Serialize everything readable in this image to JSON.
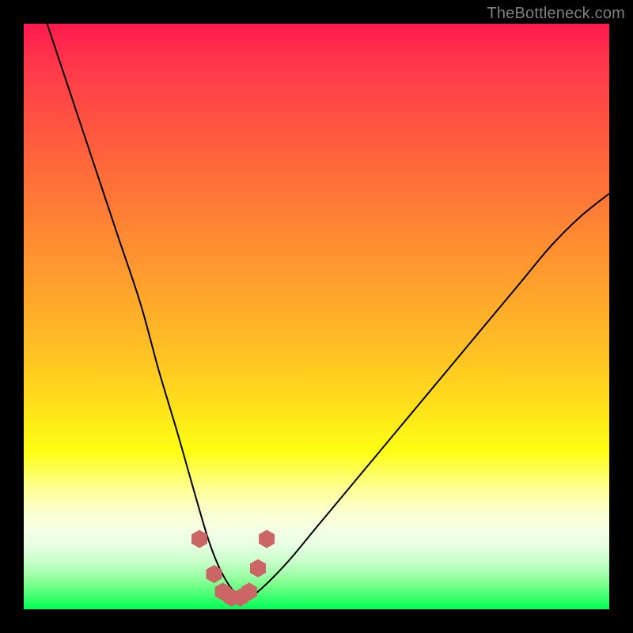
{
  "watermark": "TheBottleneck.com",
  "colors": {
    "frame": "#000000",
    "gradient_top": "#ff1a4f",
    "gradient_bottom": "#00ff57",
    "curve": "#000000",
    "points": "#cc6666",
    "watermark": "#808080"
  },
  "chart_data": {
    "type": "line",
    "title": "",
    "xlabel": "",
    "ylabel": "",
    "xlim": [
      0,
      100
    ],
    "ylim": [
      0,
      100
    ],
    "curve": {
      "name": "bottleneck-curve",
      "x": [
        4,
        8,
        12,
        16,
        20,
        23,
        26,
        28,
        30,
        31.5,
        33,
        34.5,
        36,
        38,
        40,
        45,
        50,
        55,
        60,
        65,
        70,
        75,
        80,
        85,
        90,
        95,
        100
      ],
      "y": [
        100,
        88,
        76,
        64,
        52,
        41,
        31,
        24,
        17,
        12,
        8,
        5,
        3,
        2,
        3,
        8,
        14,
        20,
        26,
        32,
        38,
        44,
        50,
        56,
        62,
        67,
        71
      ]
    },
    "series": [
      {
        "name": "highlighted-points",
        "x": [
          30.0,
          32.5,
          34.0,
          35.5,
          37.0,
          38.5,
          40.0,
          41.5
        ],
        "y": [
          12.0,
          6.0,
          3.0,
          2.0,
          2.0,
          3.0,
          7.0,
          12.0
        ]
      }
    ],
    "annotations": [
      "TheBottleneck.com"
    ]
  }
}
